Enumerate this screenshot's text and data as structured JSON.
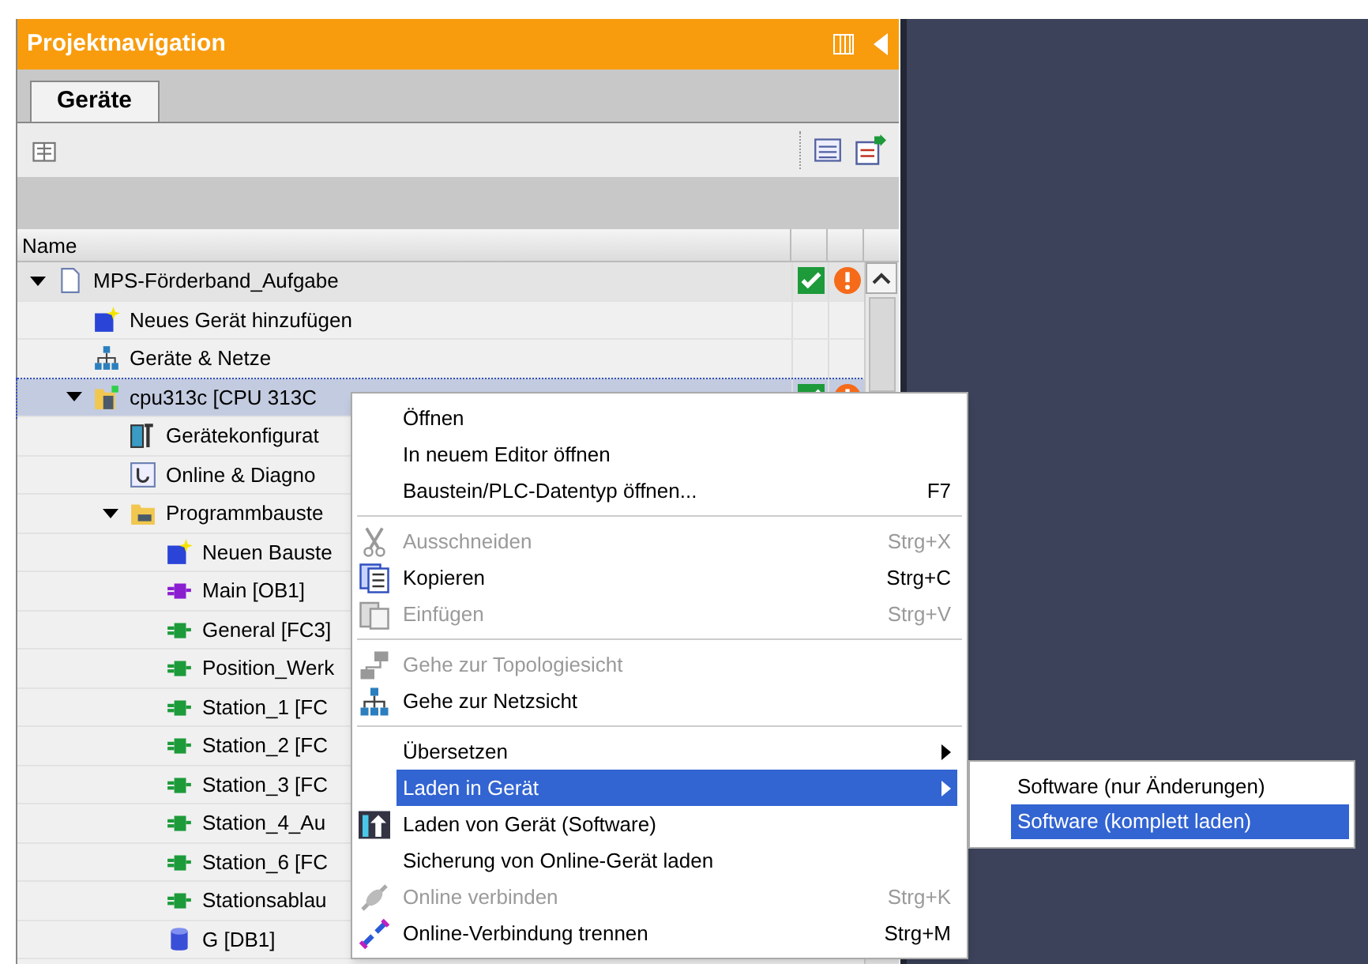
{
  "panel": {
    "title": "Projektnavigation",
    "tabs": [
      {
        "label": "Geräte",
        "selected": true
      }
    ],
    "columns": [
      "Name"
    ]
  },
  "tree": [
    {
      "kind": "project",
      "label": "MPS-Förderband_Aufgabe",
      "expanded": true,
      "selected": false,
      "ok": true,
      "warning": true,
      "children": [
        {
          "kind": "add-device",
          "label": "Neues Gerät hinzufügen",
          "selected": false,
          "ok": false,
          "warning": false
        },
        {
          "kind": "network",
          "label": "Geräte & Netze",
          "selected": false,
          "ok": false,
          "warning": false
        },
        {
          "kind": "cpu",
          "label": "cpu313c [CPU 313C",
          "expanded": true,
          "selected": true,
          "ok": true,
          "warning": true,
          "children": [
            {
              "kind": "device-config",
              "label": "Gerätekonfigurat",
              "selected": false
            },
            {
              "kind": "diagnostics",
              "label": "Online & Diagno",
              "selected": false
            },
            {
              "kind": "folder",
              "label": "Programmbauste",
              "expanded": true,
              "selected": false,
              "children": [
                {
                  "kind": "add-block",
                  "label": "Neuen Bauste",
                  "selected": false
                },
                {
                  "kind": "ob",
                  "label": "Main [OB1]",
                  "selected": false
                },
                {
                  "kind": "fc",
                  "label": "General [FC3]",
                  "selected": false
                },
                {
                  "kind": "fc",
                  "label": "Position_Werk",
                  "selected": false
                },
                {
                  "kind": "fc",
                  "label": "Station_1 [FC",
                  "selected": false
                },
                {
                  "kind": "fc",
                  "label": "Station_2 [FC",
                  "selected": false
                },
                {
                  "kind": "fc",
                  "label": "Station_3 [FC",
                  "selected": false
                },
                {
                  "kind": "fc",
                  "label": "Station_4_Au",
                  "selected": false
                },
                {
                  "kind": "fc",
                  "label": "Station_6 [FC",
                  "selected": false
                },
                {
                  "kind": "fc",
                  "label": "Stationsablau",
                  "selected": false
                },
                {
                  "kind": "db",
                  "label": "G [DB1]",
                  "selected": false
                }
              ]
            }
          ]
        }
      ]
    }
  ],
  "context_menu": [
    {
      "kind": "item",
      "label": "Öffnen",
      "disabled": false,
      "selected": false
    },
    {
      "kind": "item",
      "label": "In neuem Editor öffnen",
      "disabled": false,
      "selected": false
    },
    {
      "kind": "item",
      "label": "Baustein/PLC-Datentyp öffnen...",
      "shortcut": "F7",
      "disabled": false,
      "selected": false
    },
    {
      "kind": "separator"
    },
    {
      "kind": "scissors",
      "label": "Ausschneiden",
      "shortcut": "Strg+X",
      "disabled": true,
      "selected": false
    },
    {
      "kind": "copy",
      "label": "Kopieren",
      "shortcut": "Strg+C",
      "disabled": false,
      "selected": false
    },
    {
      "kind": "paste",
      "label": "Einfügen",
      "shortcut": "Strg+V",
      "disabled": true,
      "selected": false
    },
    {
      "kind": "separator"
    },
    {
      "kind": "topology",
      "label": "Gehe zur Topologiesicht",
      "disabled": true,
      "selected": false
    },
    {
      "kind": "network",
      "label": "Gehe zur Netzsicht",
      "disabled": false,
      "selected": false
    },
    {
      "kind": "separator"
    },
    {
      "kind": "item",
      "label": "Übersetzen",
      "submenu": true,
      "disabled": false,
      "selected": false
    },
    {
      "kind": "item",
      "label": "Laden in Gerät",
      "submenu": true,
      "disabled": false,
      "selected": true
    },
    {
      "kind": "upload",
      "label": "Laden von Gerät (Software)",
      "disabled": false,
      "selected": false
    },
    {
      "kind": "item",
      "label": "Sicherung von Online-Gerät laden",
      "disabled": false,
      "selected": false
    },
    {
      "kind": "plug",
      "label": "Online verbinden",
      "shortcut": "Strg+K",
      "disabled": true,
      "selected": false
    },
    {
      "kind": "disconnect",
      "label": "Online-Verbindung trennen",
      "shortcut": "Strg+M",
      "disabled": false,
      "selected": false
    }
  ],
  "submenu": [
    {
      "label": "Software (nur Änderungen)",
      "selected": false
    },
    {
      "label": "Software (komplett laden)",
      "selected": true
    }
  ]
}
